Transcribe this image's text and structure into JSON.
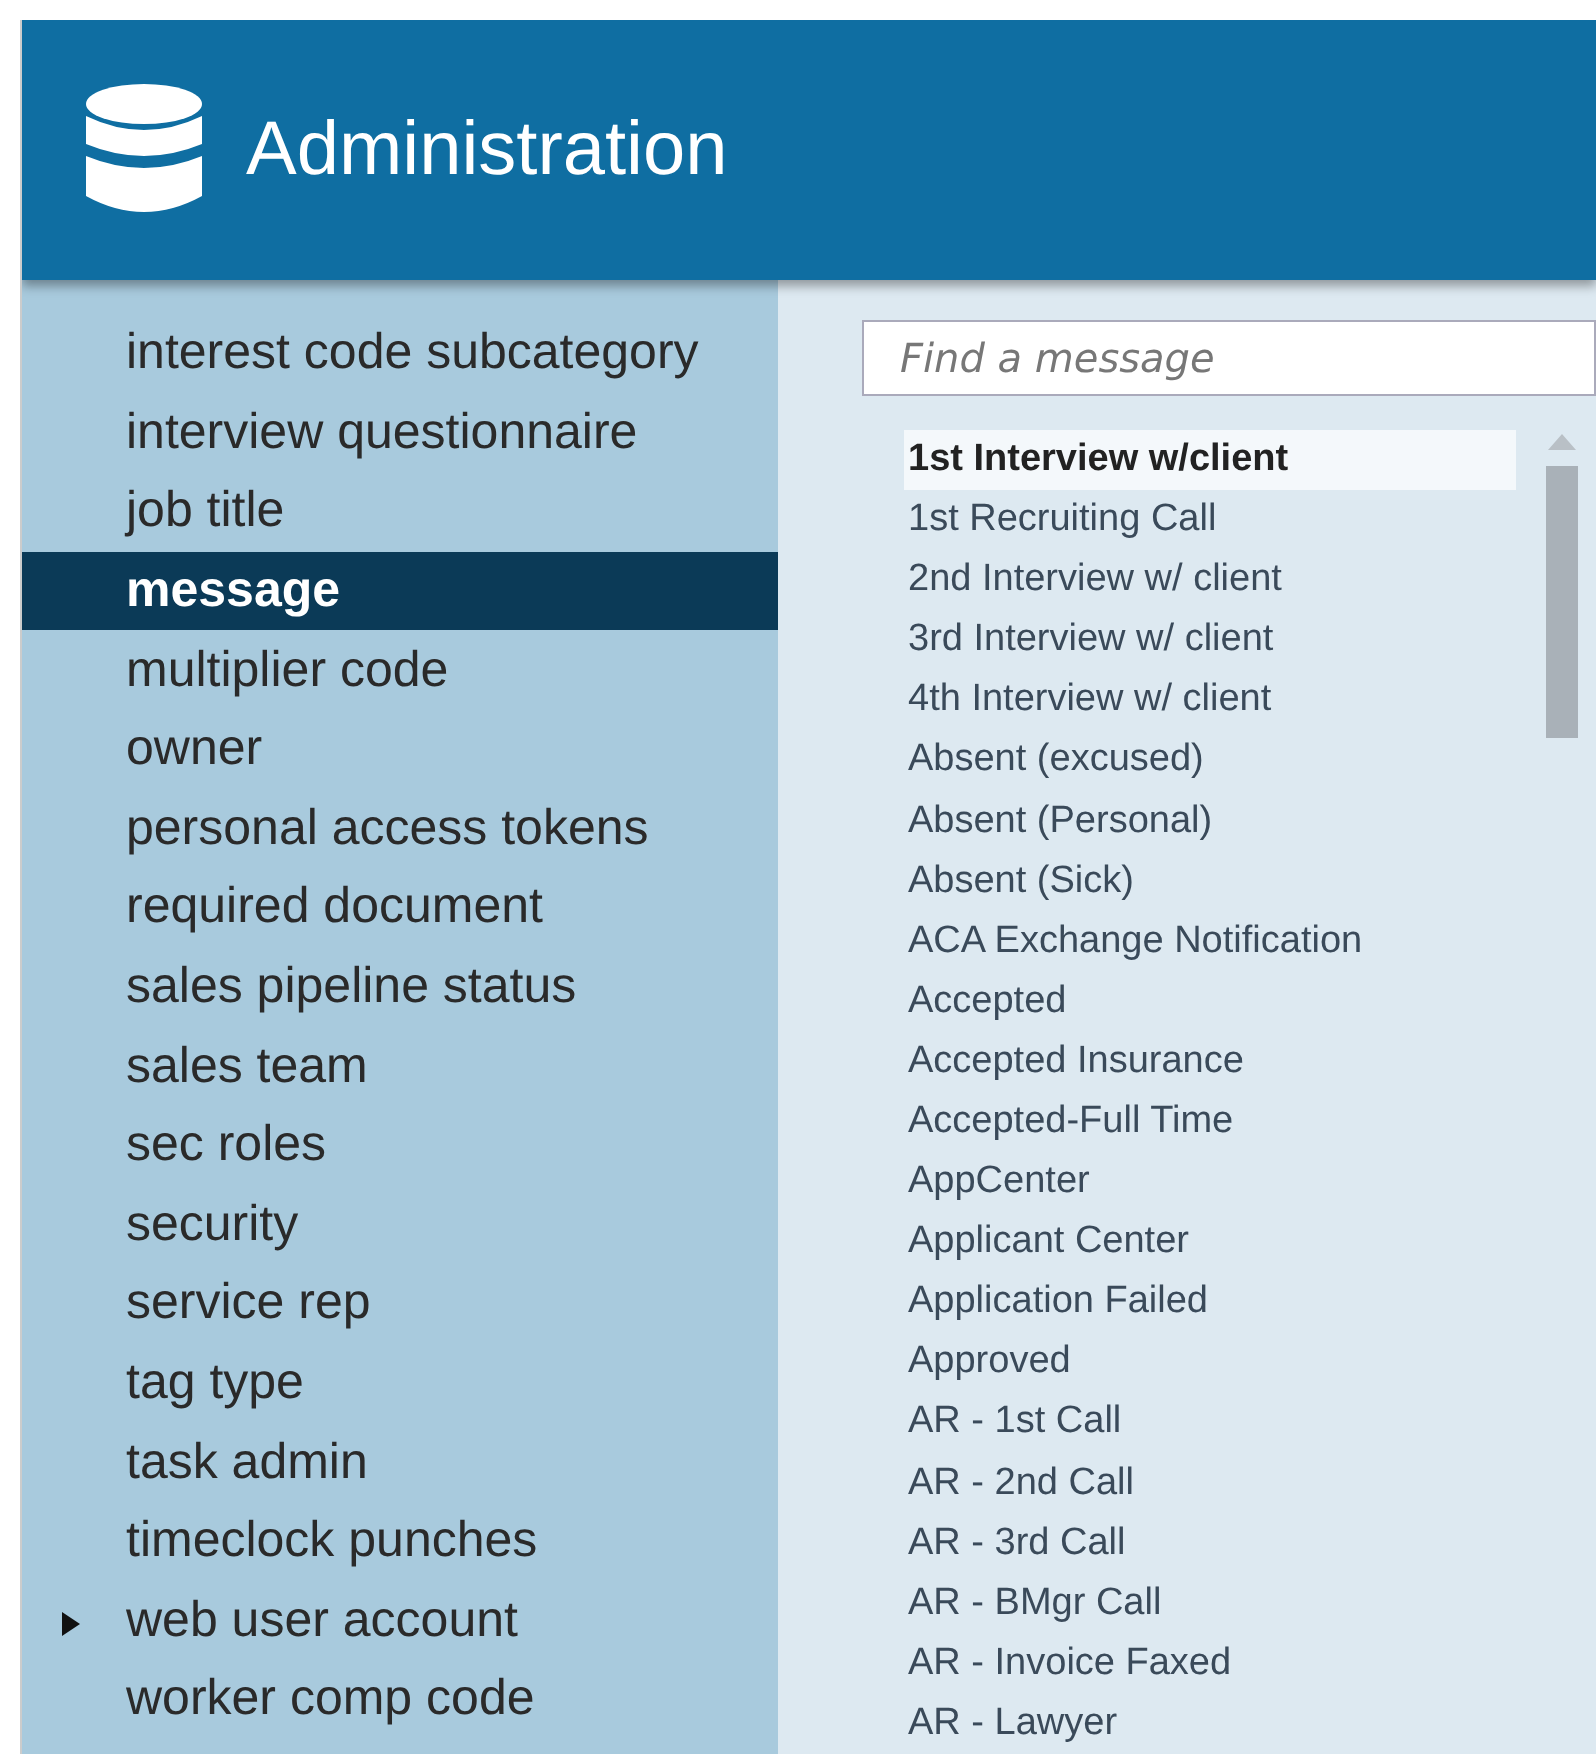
{
  "header": {
    "title": "Administration"
  },
  "sidebar": {
    "items": [
      {
        "label": "interest code subcategory",
        "selected": false,
        "expandable": false
      },
      {
        "label": "interview questionnaire",
        "selected": false,
        "expandable": false
      },
      {
        "label": "job title",
        "selected": false,
        "expandable": false
      },
      {
        "label": "message",
        "selected": true,
        "expandable": false
      },
      {
        "label": "multiplier code",
        "selected": false,
        "expandable": false
      },
      {
        "label": "owner",
        "selected": false,
        "expandable": false
      },
      {
        "label": "personal access tokens",
        "selected": false,
        "expandable": false
      },
      {
        "label": "required document",
        "selected": false,
        "expandable": false
      },
      {
        "label": "sales pipeline status",
        "selected": false,
        "expandable": false
      },
      {
        "label": "sales team",
        "selected": false,
        "expandable": false
      },
      {
        "label": "sec roles",
        "selected": false,
        "expandable": false
      },
      {
        "label": "security",
        "selected": false,
        "expandable": false
      },
      {
        "label": "service rep",
        "selected": false,
        "expandable": false
      },
      {
        "label": "tag type",
        "selected": false,
        "expandable": false
      },
      {
        "label": "task admin",
        "selected": false,
        "expandable": false
      },
      {
        "label": "timeclock punches",
        "selected": false,
        "expandable": false
      },
      {
        "label": "web user account",
        "selected": false,
        "expandable": true
      },
      {
        "label": "worker comp code",
        "selected": false,
        "expandable": false
      }
    ]
  },
  "search": {
    "placeholder": "Find a message"
  },
  "messages": [
    {
      "label": "1st Interview w/client",
      "selected": true
    },
    {
      "label": "1st Recruiting Call",
      "selected": false
    },
    {
      "label": "2nd Interview w/ client",
      "selected": false
    },
    {
      "label": "3rd Interview w/ client",
      "selected": false
    },
    {
      "label": "4th Interview w/ client",
      "selected": false
    },
    {
      "label": "Absent (excused)",
      "selected": false
    },
    {
      "label": "Absent (Personal)",
      "selected": false
    },
    {
      "label": "Absent (Sick)",
      "selected": false
    },
    {
      "label": "ACA Exchange Notification",
      "selected": false
    },
    {
      "label": "Accepted",
      "selected": false
    },
    {
      "label": "Accepted Insurance",
      "selected": false
    },
    {
      "label": "Accepted-Full Time",
      "selected": false
    },
    {
      "label": "AppCenter",
      "selected": false
    },
    {
      "label": "Applicant Center",
      "selected": false
    },
    {
      "label": "Application Failed",
      "selected": false
    },
    {
      "label": "Approved",
      "selected": false
    },
    {
      "label": "AR - 1st Call",
      "selected": false
    },
    {
      "label": "AR - 2nd Call",
      "selected": false
    },
    {
      "label": "AR - 3rd Call",
      "selected": false
    },
    {
      "label": "AR - BMgr Call",
      "selected": false
    },
    {
      "label": "AR - Invoice Faxed",
      "selected": false
    },
    {
      "label": "AR - Lawyer",
      "selected": false
    }
  ]
}
